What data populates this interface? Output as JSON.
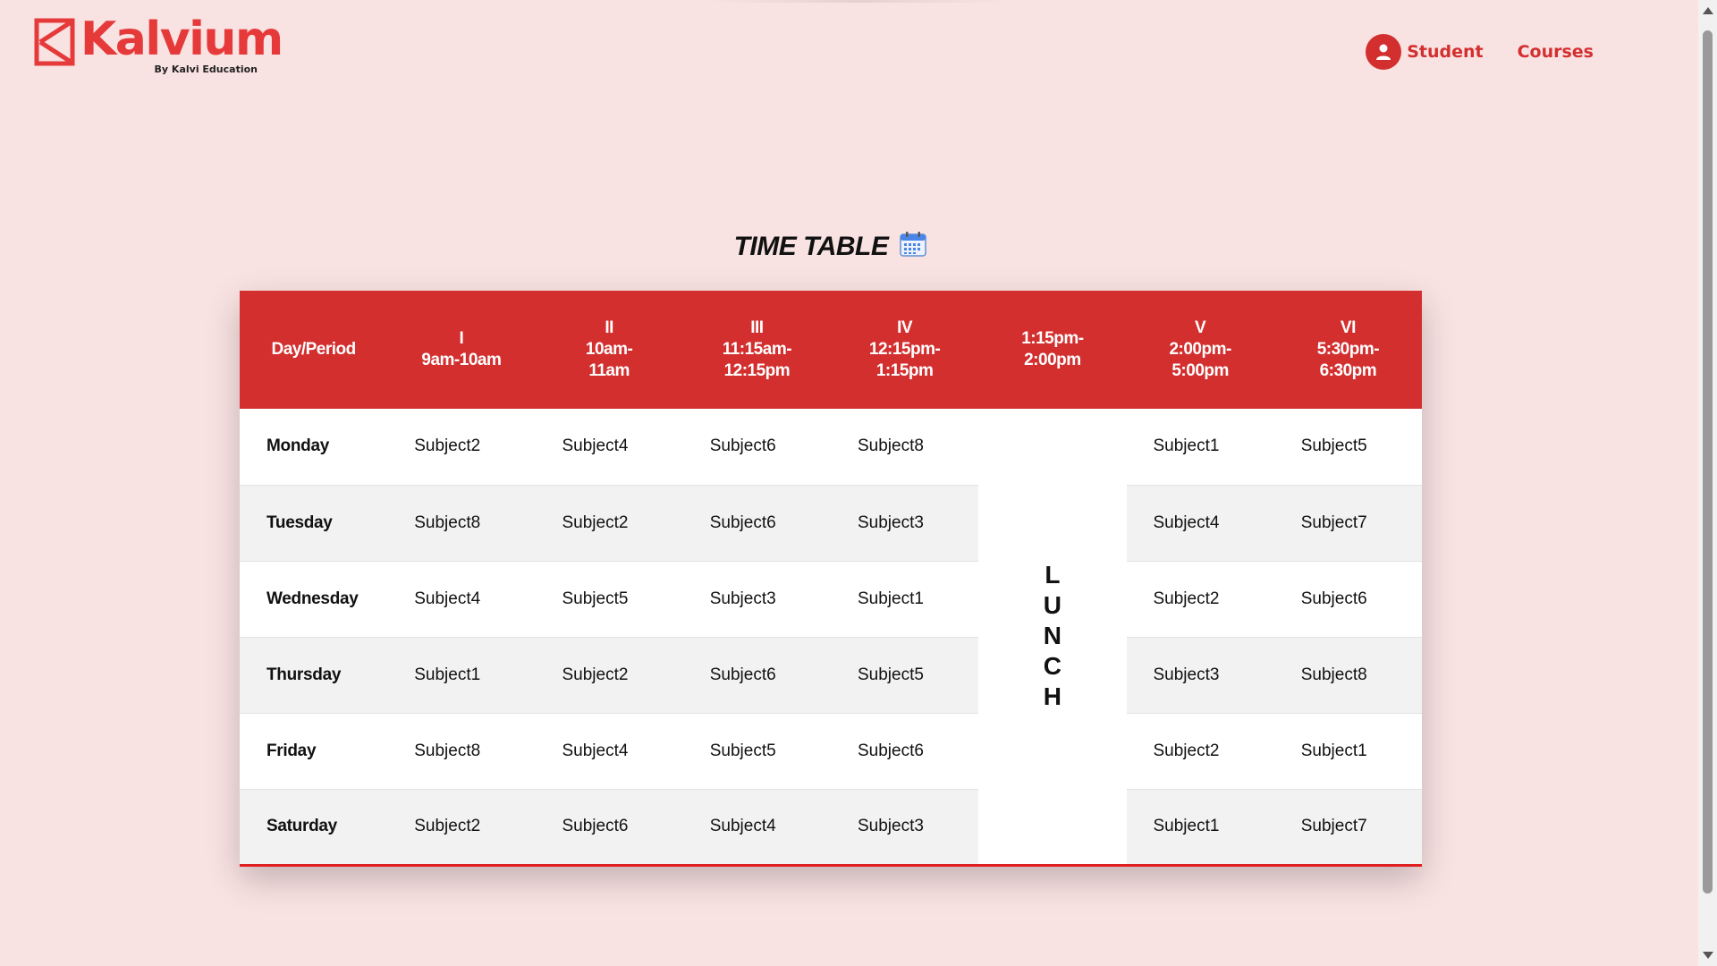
{
  "brand": {
    "name": "Kalvium",
    "tagline": "By Kalvi Education",
    "color": "#e63a3a"
  },
  "nav": {
    "student_label": "Student",
    "courses_label": "Courses",
    "icon": "user-icon"
  },
  "title": {
    "text": "TIME TABLE",
    "icon": "calendar-icon"
  },
  "timetable": {
    "header_color": "#d32f2f",
    "headers": [
      {
        "lines": [
          "Day/Period"
        ]
      },
      {
        "lines": [
          "I",
          "9am-10am"
        ]
      },
      {
        "lines": [
          "II",
          "10am-",
          "11am"
        ]
      },
      {
        "lines": [
          "III",
          "11:15am-",
          "12:15pm"
        ]
      },
      {
        "lines": [
          "IV",
          "12:15pm-",
          "1:15pm"
        ]
      },
      {
        "lines": [
          "1:15pm-",
          "2:00pm"
        ]
      },
      {
        "lines": [
          "V",
          "2:00pm-",
          "5:00pm"
        ]
      },
      {
        "lines": [
          "VI",
          "5:30pm-",
          "6:30pm"
        ]
      }
    ],
    "lunch_letters": [
      "L",
      "U",
      "N",
      "C",
      "H"
    ],
    "rows": [
      {
        "day": "Monday",
        "before_lunch": [
          "Subject2",
          "Subject4",
          "Subject6",
          "Subject8"
        ],
        "after_lunch": [
          "Subject1",
          "Subject5"
        ]
      },
      {
        "day": "Tuesday",
        "before_lunch": [
          "Subject8",
          "Subject2",
          "Subject6",
          "Subject3"
        ],
        "after_lunch": [
          "Subject4",
          "Subject7"
        ]
      },
      {
        "day": "Wednesday",
        "before_lunch": [
          "Subject4",
          "Subject5",
          "Subject3",
          "Subject1"
        ],
        "after_lunch": [
          "Subject2",
          "Subject6"
        ]
      },
      {
        "day": "Thursday",
        "before_lunch": [
          "Subject1",
          "Subject2",
          "Subject6",
          "Subject5"
        ],
        "after_lunch": [
          "Subject3",
          "Subject8"
        ]
      },
      {
        "day": "Friday",
        "before_lunch": [
          "Subject8",
          "Subject4",
          "Subject5",
          "Subject6"
        ],
        "after_lunch": [
          "Subject2",
          "Subject1"
        ]
      },
      {
        "day": "Saturday",
        "before_lunch": [
          "Subject2",
          "Subject6",
          "Subject4",
          "Subject3"
        ],
        "after_lunch": [
          "Subject1",
          "Subject7"
        ]
      }
    ]
  }
}
